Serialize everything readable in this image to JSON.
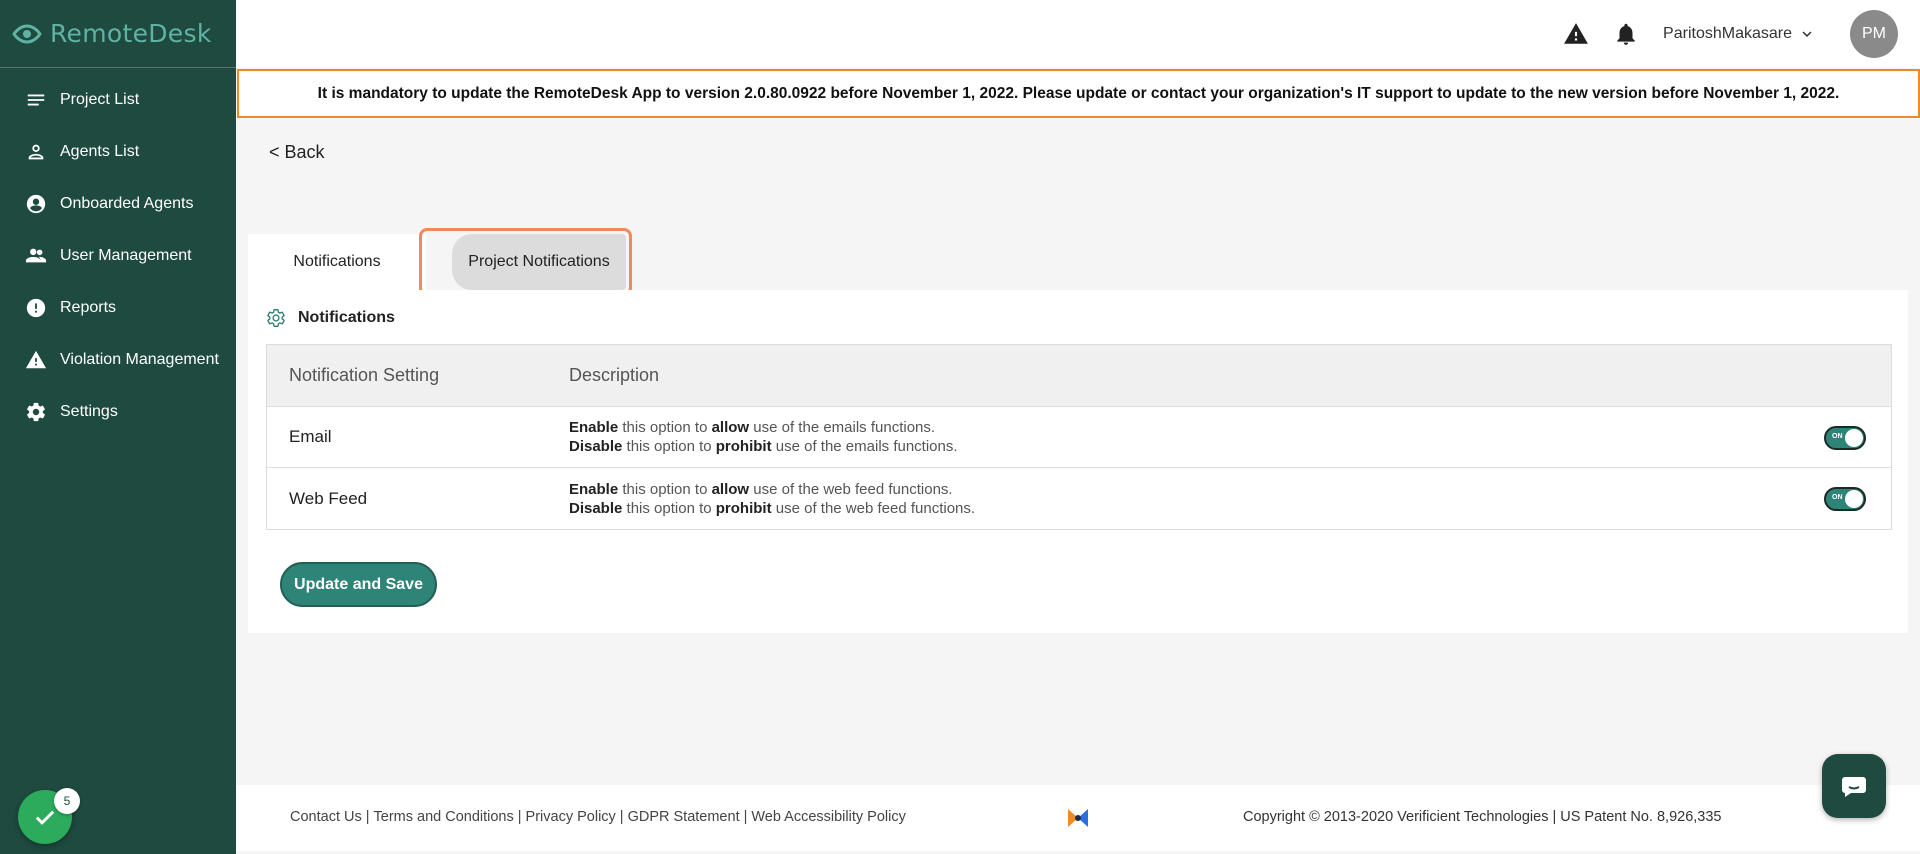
{
  "brand": {
    "name": "RemoteDesk",
    "color": "#1e4a3f",
    "accent": "#5fb3a5"
  },
  "sidebar": {
    "items": [
      {
        "label": "Project List",
        "icon": "list-icon"
      },
      {
        "label": "Agents List",
        "icon": "person-icon"
      },
      {
        "label": "Onboarded Agents",
        "icon": "account-circle-icon"
      },
      {
        "label": "User Management",
        "icon": "people-icon"
      },
      {
        "label": "Reports",
        "icon": "alert-circle-icon"
      },
      {
        "label": "Violation Management",
        "icon": "warning-icon"
      },
      {
        "label": "Settings",
        "icon": "gear-icon"
      }
    ],
    "check_badge_count": "5"
  },
  "header": {
    "user_name": "ParitoshMakasare",
    "avatar_initials": "PM"
  },
  "banner": {
    "text": "It is mandatory to update the RemoteDesk App to version 2.0.80.0922 before November 1, 2022. Please update or contact your organization's IT support to update to the new version before November 1, 2022."
  },
  "back_label": "< Back",
  "tabs": [
    {
      "label": "Notifications"
    },
    {
      "label": "Project Notifications"
    }
  ],
  "card": {
    "title": "Notifications",
    "columns": [
      "Notification Setting",
      "Description"
    ],
    "rows": [
      {
        "setting": "Email",
        "line1": {
          "a": "Enable",
          "b": " this option to ",
          "c": "allow",
          "d": " use of the emails functions."
        },
        "line2": {
          "a": "Disable",
          "b": " this option to ",
          "c": "prohibit",
          "d": " use of the emails functions."
        },
        "toggle": "ON"
      },
      {
        "setting": "Web Feed",
        "line1": {
          "a": "Enable",
          "b": " this option to ",
          "c": "allow",
          "d": " use of the web feed functions."
        },
        "line2": {
          "a": "Disable",
          "b": " this option to ",
          "c": "prohibit",
          "d": " use of the web feed functions."
        },
        "toggle": "ON"
      }
    ],
    "save_label": "Update and Save"
  },
  "footer": {
    "links": [
      "Contact Us",
      "Terms and Conditions ",
      "Privacy Policy ",
      "GDPR Statement",
      "Web Accessibility Policy"
    ],
    "copyright": "Copyright © 2013-2020 Verificient Technologies | US Patent No. 8,926,335"
  }
}
